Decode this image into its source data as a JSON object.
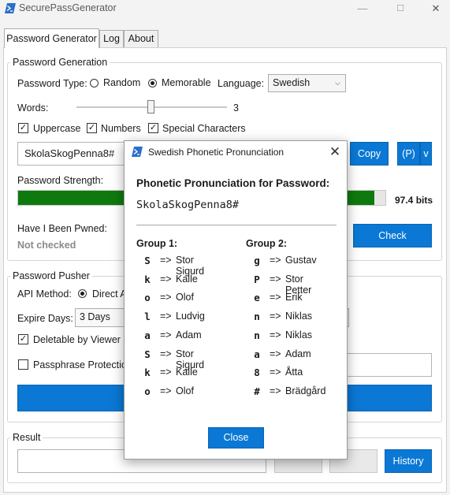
{
  "window": {
    "title": "SecurePassGenerator",
    "controls": [
      "—",
      "☐",
      "✕"
    ]
  },
  "tabs": [
    {
      "label": "Password Generator",
      "active": true
    },
    {
      "label": "Log",
      "active": false
    },
    {
      "label": "About",
      "active": false
    }
  ],
  "generation": {
    "group_title": "Password Generation",
    "type_label": "Password Type:",
    "type_options": [
      "Random",
      "Memorable"
    ],
    "type_selected": "Memorable",
    "language_label": "Language:",
    "language_value": "Swedish",
    "words_label": "Words:",
    "words_value": "3",
    "checkboxes": [
      {
        "label": "Uppercase",
        "checked": true
      },
      {
        "label": "Numbers",
        "checked": true
      },
      {
        "label": "Special Characters",
        "checked": true
      }
    ],
    "password_value": "SkolaSkogPenna8#",
    "copy_label": "Copy",
    "p_label": "(P)",
    "v_label": "v",
    "strength_label": "Password Strength:",
    "strength_bits": "97.4 bits",
    "strength_fraction": 0.97,
    "pwned_label": "Have I Been Pwned:",
    "pwned_status": "Not checked",
    "check_label": "Check"
  },
  "pusher": {
    "group_title": "Password Pusher",
    "api_label": "API Method:",
    "api_option": "Direct A",
    "expire_label": "Expire Days:",
    "expire_value": "3 Days",
    "deletable_label": "Deletable by Viewer",
    "deletable_checked": true,
    "passphrase_label": "Passphrase Protection",
    "passphrase_checked": false
  },
  "result": {
    "group_title": "Result",
    "history_label": "History"
  },
  "dialog": {
    "title": "Swedish Phonetic Pronunciation",
    "heading": "Phonetic Pronunciation for Password:",
    "password": "SkolaSkogPenna8#",
    "group1_title": "Group 1:",
    "group2_title": "Group 2:",
    "group1": [
      {
        "char": "S",
        "arrow": "=>",
        "word": "Stor Sigurd"
      },
      {
        "char": "k",
        "arrow": "=>",
        "word": "Kalle"
      },
      {
        "char": "o",
        "arrow": "=>",
        "word": "Olof"
      },
      {
        "char": "l",
        "arrow": "=>",
        "word": "Ludvig"
      },
      {
        "char": "a",
        "arrow": "=>",
        "word": "Adam"
      },
      {
        "char": "S",
        "arrow": "=>",
        "word": "Stor Sigurd"
      },
      {
        "char": "k",
        "arrow": "=>",
        "word": "Kalle"
      },
      {
        "char": "o",
        "arrow": "=>",
        "word": "Olof"
      }
    ],
    "group2": [
      {
        "char": "g",
        "arrow": "=>",
        "word": "Gustav"
      },
      {
        "char": "P",
        "arrow": "=>",
        "word": "Stor Petter"
      },
      {
        "char": "e",
        "arrow": "=>",
        "word": "Erik"
      },
      {
        "char": "n",
        "arrow": "=>",
        "word": "Niklas"
      },
      {
        "char": "n",
        "arrow": "=>",
        "word": "Niklas"
      },
      {
        "char": "a",
        "arrow": "=>",
        "word": "Adam"
      },
      {
        "char": "8",
        "arrow": "=>",
        "word": "Åtta"
      },
      {
        "char": "#",
        "arrow": "=>",
        "word": "Brädgård"
      }
    ],
    "close_label": "Close"
  },
  "colors": {
    "accent": "#0a78d4",
    "strength_bar": "#0e7a0d"
  }
}
